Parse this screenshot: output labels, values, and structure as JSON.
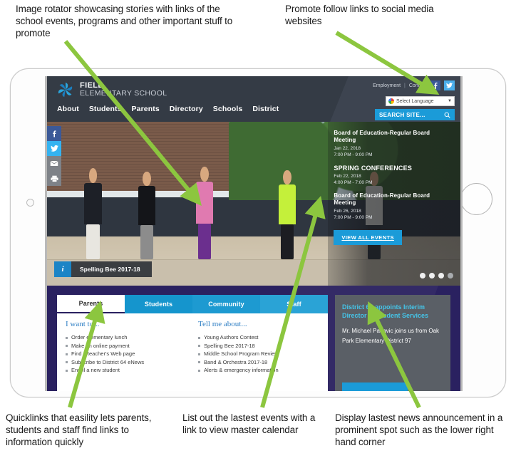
{
  "annotations": {
    "rotator": "Image rotator showcasing stories with links of the school events, programs and other important stuff to promote",
    "social": "Promote follow links to social media websites",
    "quicklinks": "Quicklinks that easility lets parents, students and staff find links to information quickly",
    "events": "List out the lastest events with a link to view master calendar",
    "news": "Display lastest news announcement in a prominent spot such as the lower right hand corner"
  },
  "site": {
    "logo": {
      "line1": "FIELD",
      "line2": "ELEMENTARY SCHOOL",
      "icon": "pinwheel-logo-icon"
    },
    "utility": {
      "employment": "Employment",
      "separator": "|",
      "contact": "Contact",
      "facebook": "f",
      "twitter": "t"
    },
    "language": {
      "label": "Select Language",
      "caret": "▼",
      "icon": "google-translate-icon"
    },
    "search": {
      "placeholder": "SEARCH SITE...",
      "icon": "search-icon"
    },
    "nav": [
      {
        "label": "About"
      },
      {
        "label": "Students"
      },
      {
        "label": "Parents"
      },
      {
        "label": "Directory"
      },
      {
        "label": "Schools"
      },
      {
        "label": "District"
      }
    ],
    "social_rail": [
      {
        "name": "facebook",
        "glyph": "f"
      },
      {
        "name": "twitter",
        "glyph": "t"
      },
      {
        "name": "email",
        "glyph": "✉"
      },
      {
        "name": "print",
        "glyph": "⎙"
      }
    ],
    "hero": {
      "caption": "Spelling Bee 2017-18",
      "caption_icon": "info-icon",
      "dots": 4,
      "active_dot_count": 3
    },
    "events_panel": {
      "items": [
        {
          "title": "Board of Education-Regular Board Meeting",
          "date": "Jan 22, 2018",
          "time": "7:00 PM - 9:00 PM",
          "caps": false
        },
        {
          "title": "SPRING CONFERENCES",
          "date": "Feb 22, 2018",
          "time": "4:00 PM - 7:00 PM",
          "caps": true
        },
        {
          "title": "Board of Education-Regular Board Meeting",
          "date": "Feb 26, 2018",
          "time": "7:00 PM - 9:00 PM",
          "caps": false
        }
      ],
      "button": "VIEW ALL EVENTS"
    },
    "quicklinks": {
      "tabs": [
        {
          "label": "Parents",
          "active": true
        },
        {
          "label": "Students",
          "active": false
        },
        {
          "label": "Community",
          "active": false
        },
        {
          "label": "Staff",
          "active": false
        }
      ],
      "columns": [
        {
          "heading": "I want to...",
          "links": [
            "Order elementary lunch",
            "Make an online payment",
            "Find a teacher's Web page",
            "Subscribe to District 64 eNews",
            "Enroll a new student"
          ]
        },
        {
          "heading": "Tell me about...",
          "links": [
            "Young Authors Contest",
            "Spelling Bee 2017-18",
            "Middle School Program Review",
            "Band & Orchestra 2017-18",
            "Alerts & emergency information"
          ]
        }
      ]
    },
    "news_panel": {
      "headline": "District 64 appoints Interim Director of Student Services",
      "body": "Mr. Michael Padavic joins us from Oak Park Elementary District 97"
    }
  },
  "colors": {
    "header_dark": "#343b45",
    "accent_blue": "#1b9bd8",
    "band_purple": "#2a2160",
    "news_gray": "#5a5f66",
    "arrow_green": "#8cc63f",
    "facebook": "#3b5998",
    "twitter": "#34b3f1"
  }
}
